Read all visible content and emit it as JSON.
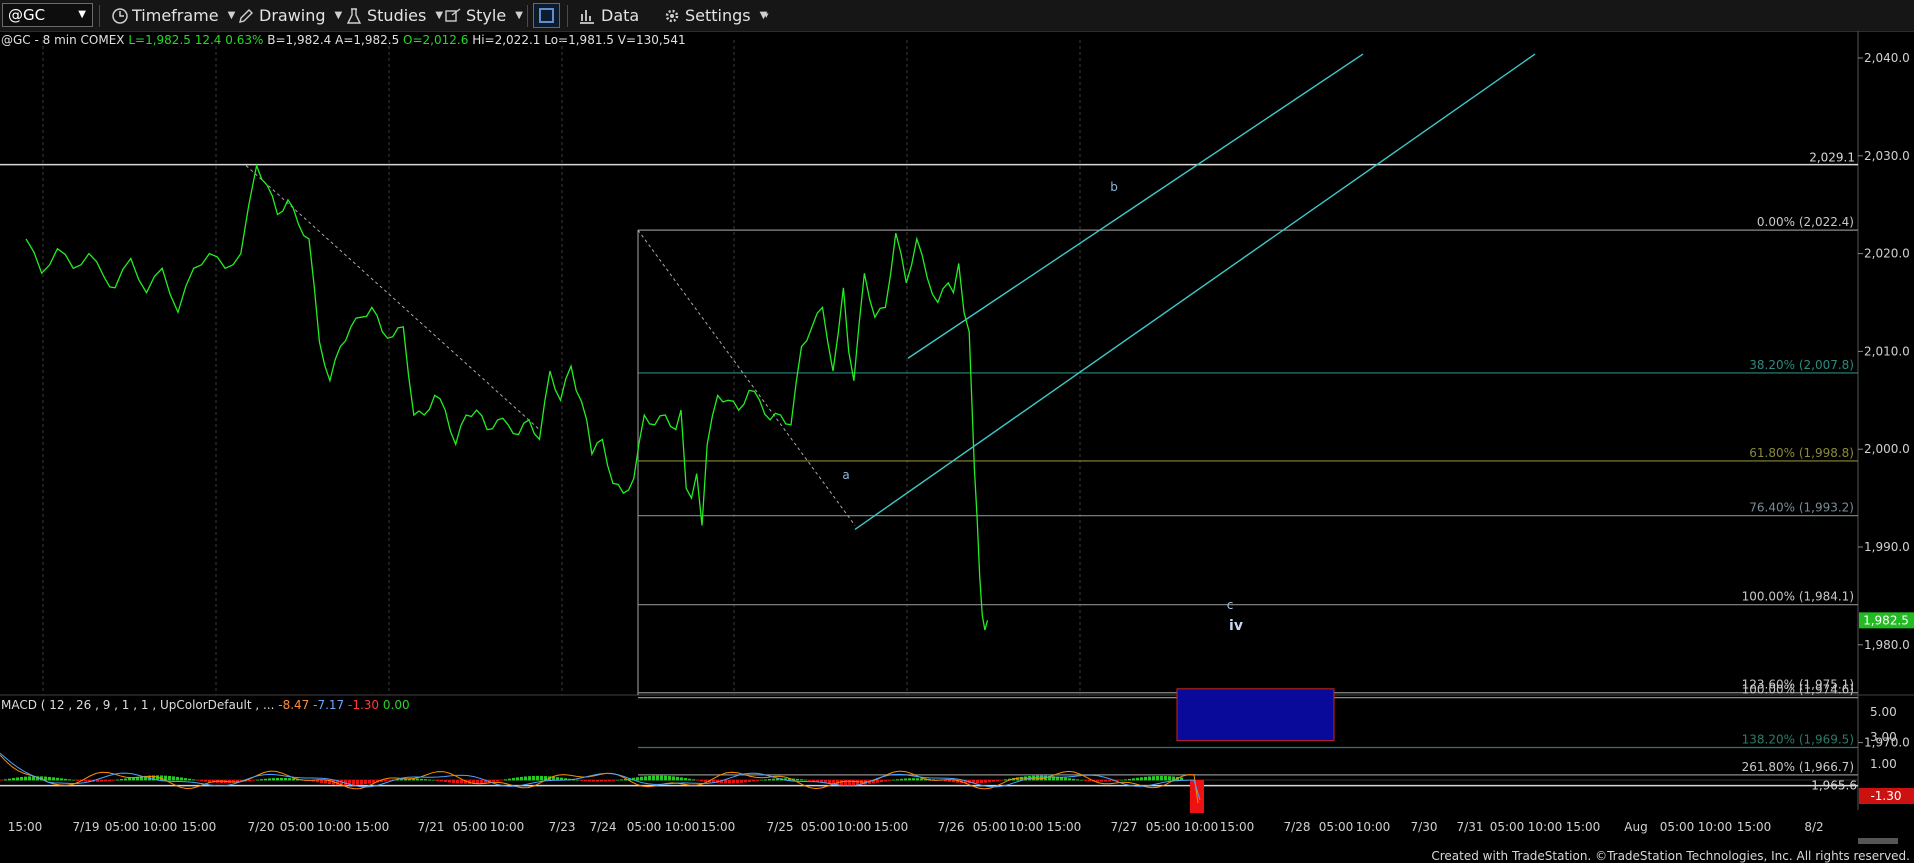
{
  "toolbar": {
    "symbol": "@GC",
    "timeframe_label": "Timeframe",
    "drawing_label": "Drawing",
    "studies_label": "Studies",
    "style_label": "Style",
    "data_label": "Data",
    "settings_label": "Settings"
  },
  "infobar": {
    "prefix": "@GC - 8 min  COMEX",
    "last": "L=1,982.5",
    "change": "12.4",
    "change_pct": "0.63%",
    "bid": "B=1,982.4",
    "ask": "A=1,982.5",
    "open": "O=2,012.6",
    "high": "Hi=2,022.1",
    "low": "Lo=1,981.5",
    "volume": "V=130,541"
  },
  "macd": {
    "label": "MACD ( 12 , 26 , 9 , 1 , 1 , UpColorDefault , ...",
    "v1": "-8.47",
    "v2": "-7.17",
    "v3": "-1.30",
    "v4": "0.00",
    "ticks": [
      "5.00",
      "3.00",
      "1.00"
    ],
    "current": "-1.30",
    "colors": {
      "macd_line": "#ff8c00",
      "signal_line": "#4aa3ff",
      "hist_pos": "#22cc22",
      "hist_neg": "#ee1111"
    }
  },
  "footer": "Created with TradeStation. ©TradeStation Technologies, Inc. All rights reserved.",
  "chart_data": {
    "type": "line",
    "instrument": "@GC",
    "interval": "8 min",
    "y_range": [
      1962,
      2044
    ],
    "y_ticks": [
      "2,040.0",
      "2,030.0",
      "2,020.0",
      "2,010.0",
      "2,000.0",
      "1,990.0",
      "1,980.0",
      "1,970.0"
    ],
    "x_ticks": [
      "15:00",
      "7/19",
      "05:00",
      "10:00",
      "15:00",
      "7/20",
      "05:00",
      "10:00",
      "15:00",
      "7/21",
      "05:00",
      "10:00",
      "7/23",
      "7/24",
      "05:00",
      "10:00",
      "15:00",
      "7/25",
      "05:00",
      "10:00",
      "15:00",
      "7/26",
      "05:00",
      "10:00",
      "15:00",
      "7/27",
      "05:00",
      "10:00",
      "15:00",
      "7/28",
      "05:00",
      "10:00",
      "7/30",
      "7/31",
      "05:00",
      "10:00",
      "15:00",
      "Aug",
      "05:00",
      "10:00",
      "15:00",
      "8/2"
    ],
    "last_price": "1,982.5",
    "price_path": [
      [
        0,
        2021.5
      ],
      [
        3,
        2018
      ],
      [
        6,
        2020.5
      ],
      [
        9,
        2018.5
      ],
      [
        12,
        2020
      ],
      [
        15,
        2017.5
      ],
      [
        17,
        2016.5
      ],
      [
        20,
        2019.5
      ],
      [
        23,
        2016
      ],
      [
        26,
        2018.5
      ],
      [
        29,
        2014
      ],
      [
        32,
        2018.5
      ],
      [
        35,
        2020
      ],
      [
        38,
        2018.5
      ],
      [
        41,
        2020
      ],
      [
        44,
        2029
      ],
      [
        46,
        2027
      ],
      [
        48,
        2024
      ],
      [
        50,
        2025.5
      ],
      [
        52,
        2023
      ],
      [
        54,
        2021.5
      ],
      [
        56,
        2011
      ],
      [
        58,
        2007
      ],
      [
        60,
        2010.5
      ],
      [
        62,
        2012.5
      ],
      [
        64,
        2013.5
      ],
      [
        66,
        2014.5
      ],
      [
        68,
        2012
      ],
      [
        70,
        2011.5
      ],
      [
        72,
        2012.5
      ],
      [
        74,
        2003.5
      ],
      [
        76,
        2003.5
      ],
      [
        78,
        2005.5
      ],
      [
        80,
        2004
      ],
      [
        82,
        2000.5
      ],
      [
        84,
        2003.5
      ],
      [
        86,
        2004
      ],
      [
        88,
        2002
      ],
      [
        90,
        2003
      ],
      [
        92,
        2002.5
      ],
      [
        94,
        2001.5
      ],
      [
        96,
        2003
      ],
      [
        98,
        2001
      ],
      [
        100,
        2008
      ],
      [
        102,
        2005
      ],
      [
        104,
        2008.5
      ],
      [
        105,
        2006
      ],
      [
        107,
        2003
      ],
      [
        108,
        1999.5
      ],
      [
        110,
        2001
      ],
      [
        112,
        1996.5
      ],
      [
        114,
        1995.5
      ],
      [
        116,
        1997
      ],
      [
        118,
        2003.5
      ],
      [
        120,
        2002.5
      ],
      [
        122,
        2003.5
      ],
      [
        124,
        2002
      ],
      [
        125,
        2004
      ],
      [
        126,
        1996
      ],
      [
        127,
        1995
      ],
      [
        128,
        1997.5
      ],
      [
        129,
        1992.2
      ],
      [
        130,
        2000.5
      ],
      [
        132,
        2005.5
      ],
      [
        134,
        2005
      ],
      [
        136,
        2004
      ],
      [
        138,
        2006
      ],
      [
        140,
        2005
      ],
      [
        142,
        2003
      ],
      [
        144,
        2003.5
      ],
      [
        146,
        2002.5
      ],
      [
        148,
        2010.5
      ],
      [
        150,
        2012.5
      ],
      [
        152,
        2014.5
      ],
      [
        153,
        2011
      ],
      [
        154,
        2008
      ],
      [
        156,
        2016.5
      ],
      [
        157,
        2010
      ],
      [
        158,
        2007
      ],
      [
        160,
        2018
      ],
      [
        162,
        2013.5
      ],
      [
        164,
        2014.5
      ],
      [
        166,
        2022.1
      ],
      [
        168,
        2017
      ],
      [
        170,
        2021.5
      ],
      [
        172,
        2017.5
      ],
      [
        174,
        2015
      ],
      [
        176,
        2017
      ],
      [
        177,
        2016
      ],
      [
        178,
        2019
      ],
      [
        179,
        2014
      ],
      [
        180,
        2012
      ],
      [
        180.5,
        2005
      ],
      [
        181,
        1998
      ],
      [
        181.5,
        1993
      ],
      [
        182,
        1987
      ],
      [
        182.5,
        1983
      ],
      [
        183,
        1981.5
      ],
      [
        183.5,
        1982.5
      ]
    ],
    "fib_levels": [
      {
        "label": "0.00% (2,022.4)",
        "price": 2022.4
      },
      {
        "label": "38.20% (2,007.8)",
        "price": 2007.8
      },
      {
        "label": "61.80% (1,998.8)",
        "price": 1998.8
      },
      {
        "label": "76.40% (1,993.2)",
        "price": 1993.2
      },
      {
        "label": "100.00% (1,984.1)",
        "price": 1984.1
      },
      {
        "label": "123.60% (1,975.1)",
        "price": 1975.1
      },
      {
        "label": "100.00% (1,974.6)",
        "price": 1974.6
      },
      {
        "label": "138.20% (1,969.5)",
        "price": 1969.5
      },
      {
        "label": "261.80% (1,966.7)",
        "price": 1966.7
      }
    ],
    "horizontal_lines": [
      {
        "label": "2,029.1",
        "price": 2029.1
      },
      {
        "label": "1,965.6",
        "price": 1965.6
      }
    ],
    "wave_labels": [
      "a",
      "b",
      "c",
      "iv"
    ],
    "target_zone": {
      "price_top": 1975.5,
      "price_bottom": 1970.2
    },
    "colors": {
      "price": "#22ee22",
      "channel": "#3ec8c8",
      "fib_38": "#2a8a80",
      "fib_618": "#8a8a3a",
      "fib_1382": "#2a7a6a",
      "target_fill": "#0a0a9a",
      "target_border": "#cc2222",
      "last_price_tag": "#22bb22"
    }
  }
}
